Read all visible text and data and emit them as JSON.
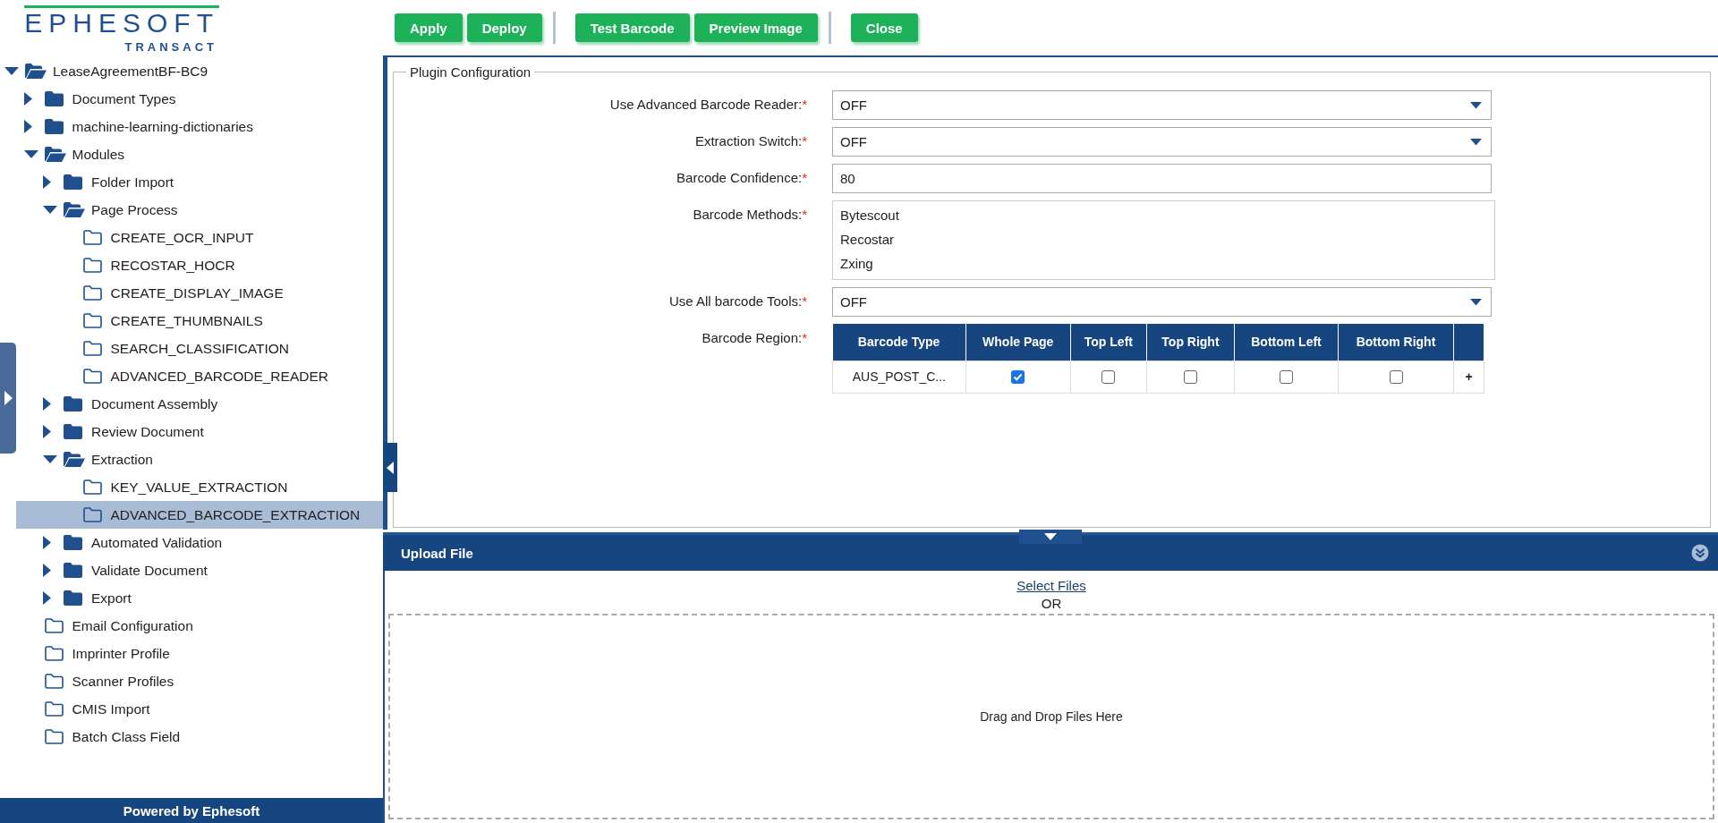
{
  "logo": {
    "name": "EPHESOFT",
    "tagline": "TRANSACT"
  },
  "toolbar": {
    "groups": [
      [
        {
          "label": "Apply"
        },
        {
          "label": "Deploy"
        }
      ],
      [
        {
          "label": "Test Barcode"
        },
        {
          "label": "Preview Image"
        }
      ],
      [
        {
          "label": "Close"
        }
      ]
    ]
  },
  "tree": [
    {
      "label": "LeaseAgreementBF-BC9",
      "kind": "branch",
      "expanded": true,
      "selected": false,
      "children": [
        {
          "label": "Document Types",
          "kind": "branch",
          "expanded": false,
          "selected": false
        },
        {
          "label": "machine-learning-dictionaries",
          "kind": "branch",
          "expanded": false,
          "selected": false
        },
        {
          "label": "Modules",
          "kind": "branch",
          "expanded": true,
          "selected": false,
          "children": [
            {
              "label": "Folder Import",
              "kind": "branch",
              "expanded": false,
              "selected": false
            },
            {
              "label": "Page Process",
              "kind": "branch",
              "expanded": true,
              "selected": false,
              "children": [
                {
                  "label": "CREATE_OCR_INPUT",
                  "kind": "leaf",
                  "selected": false
                },
                {
                  "label": "RECOSTAR_HOCR",
                  "kind": "leaf",
                  "selected": false
                },
                {
                  "label": "CREATE_DISPLAY_IMAGE",
                  "kind": "leaf",
                  "selected": false
                },
                {
                  "label": "CREATE_THUMBNAILS",
                  "kind": "leaf",
                  "selected": false
                },
                {
                  "label": "SEARCH_CLASSIFICATION",
                  "kind": "leaf",
                  "selected": false
                },
                {
                  "label": "ADVANCED_BARCODE_READER",
                  "kind": "leaf",
                  "selected": false
                }
              ]
            },
            {
              "label": "Document Assembly",
              "kind": "branch",
              "expanded": false,
              "selected": false
            },
            {
              "label": "Review Document",
              "kind": "branch",
              "expanded": false,
              "selected": false
            },
            {
              "label": "Extraction",
              "kind": "branch",
              "expanded": true,
              "selected": false,
              "children": [
                {
                  "label": "KEY_VALUE_EXTRACTION",
                  "kind": "leaf",
                  "selected": false
                },
                {
                  "label": "ADVANCED_BARCODE_EXTRACTION",
                  "kind": "leaf",
                  "selected": true
                }
              ]
            },
            {
              "label": "Automated Validation",
              "kind": "branch",
              "expanded": false,
              "selected": false
            },
            {
              "label": "Validate Document",
              "kind": "branch",
              "expanded": false,
              "selected": false
            },
            {
              "label": "Export",
              "kind": "branch",
              "expanded": false,
              "selected": false
            }
          ]
        },
        {
          "label": "Email Configuration",
          "kind": "leaf",
          "selected": false
        },
        {
          "label": "Imprinter Profile",
          "kind": "leaf",
          "selected": false
        },
        {
          "label": "Scanner Profiles",
          "kind": "leaf",
          "selected": false
        },
        {
          "label": "CMIS Import",
          "kind": "leaf",
          "selected": false
        },
        {
          "label": "Batch Class Field",
          "kind": "leaf",
          "selected": false
        }
      ]
    }
  ],
  "footer": "Powered by Ephesoft",
  "plugin_configuration": {
    "title": "Plugin Configuration",
    "fields": [
      {
        "kind": "select",
        "label": "Use Advanced Barcode Reader:",
        "required_mark": "*",
        "value": "OFF"
      },
      {
        "kind": "select",
        "label": "Extraction Switch:",
        "required_mark": "*",
        "value": "OFF"
      },
      {
        "kind": "text",
        "label": "Barcode Confidence:",
        "required_mark": "*",
        "value": "80"
      },
      {
        "kind": "list",
        "label": "Barcode Methods:",
        "required_mark": "*",
        "options": [
          "Bytescout",
          "Recostar",
          "Zxing"
        ]
      },
      {
        "kind": "select",
        "label": "Use All barcode Tools:",
        "required_mark": "*",
        "value": "OFF"
      },
      {
        "kind": "table",
        "label": "Barcode Region:",
        "required_mark": "*",
        "columns": [
          "Barcode Type",
          "Whole Page",
          "Top Left",
          "Top Right",
          "Bottom Left",
          "Bottom Right"
        ],
        "rows": [
          {
            "barcode_type": "AUS_POST_C...",
            "regions": [
              {
                "checked": true
              },
              {
                "checked": false
              },
              {
                "checked": false
              },
              {
                "checked": false
              },
              {
                "checked": false
              }
            ],
            "add": "+"
          }
        ]
      }
    ]
  },
  "upload": {
    "title": "Upload File",
    "link": "Select Files",
    "separator": "OR",
    "drop_text": "Drag and Drop Files Here"
  }
}
